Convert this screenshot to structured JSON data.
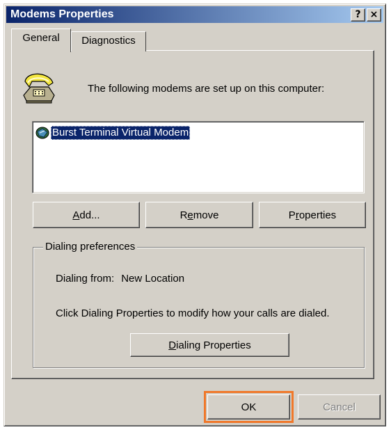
{
  "window": {
    "title": "Modems Properties",
    "help_glyph": "?",
    "close_glyph": "×"
  },
  "tabs": [
    {
      "label": "General",
      "active": true
    },
    {
      "label": "Diagnostics",
      "active": false
    }
  ],
  "intro_text": "The following modems are set up on this computer:",
  "modems": [
    {
      "name": "Burst Terminal Virtual Modem",
      "selected": true,
      "icon": "modem-icon"
    }
  ],
  "buttons": {
    "add": {
      "before": "",
      "key": "A",
      "after": "dd..."
    },
    "remove": {
      "before": "R",
      "key": "e",
      "after": "move"
    },
    "properties": {
      "before": "P",
      "key": "r",
      "after": "operties"
    }
  },
  "dialing": {
    "legend": "Dialing preferences",
    "from_label": "Dialing from:",
    "from_value": "New Location",
    "info_text": "Click Dialing Properties to modify how your calls are dialed.",
    "button": {
      "before": "",
      "key": "D",
      "after": "ialing Properties"
    }
  },
  "footer": {
    "ok_label": "OK",
    "cancel_label": "Cancel",
    "cancel_disabled": true
  },
  "icons": {
    "header_icon": "phone-icon"
  },
  "colors": {
    "titlebar_start": "#0a246a",
    "titlebar_end": "#a6caf0",
    "face": "#d4d0c8",
    "selection": "#0a246a",
    "ok_highlight": "#f0782a"
  }
}
